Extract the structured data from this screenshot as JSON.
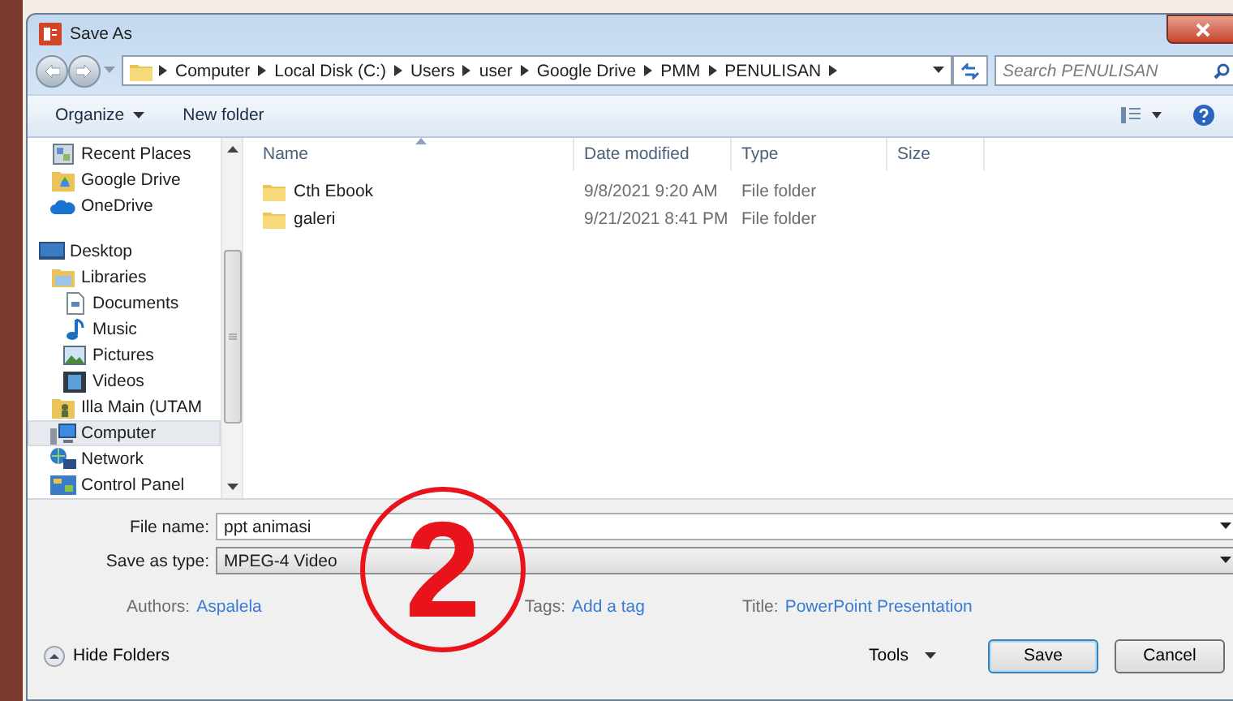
{
  "window": {
    "title": "Save As"
  },
  "address": {
    "crumbs": [
      "Computer",
      "Local Disk (C:)",
      "Users",
      "user",
      "Google Drive",
      "PMM",
      "PENULISAN"
    ]
  },
  "search": {
    "placeholder": "Search PENULISAN"
  },
  "toolbar": {
    "items": [
      {
        "label": "Organize",
        "menu": true
      },
      {
        "label": "New folder",
        "menu": false
      }
    ]
  },
  "nav": {
    "favorites": [
      {
        "label": "Recent Places",
        "kind": "recent",
        "selected": false
      },
      {
        "label": "Google Drive",
        "kind": "gdrive",
        "selected": false
      },
      {
        "label": "OneDrive",
        "kind": "cloud",
        "selected": false
      }
    ],
    "tree": [
      {
        "label": "Desktop",
        "kind": "desktop",
        "selected": false,
        "children": [
          {
            "label": "Libraries",
            "kind": "library",
            "selected": false,
            "children": [
              {
                "label": "Documents",
                "kind": "document",
                "selected": false
              },
              {
                "label": "Music",
                "kind": "music",
                "selected": false
              },
              {
                "label": "Pictures",
                "kind": "picture",
                "selected": false
              },
              {
                "label": "Videos",
                "kind": "video",
                "selected": false
              }
            ]
          },
          {
            "label": "Illa Main (UTAM",
            "kind": "user",
            "selected": false
          },
          {
            "label": "Computer",
            "kind": "computer",
            "selected": true
          },
          {
            "label": "Network",
            "kind": "network",
            "selected": false
          },
          {
            "label": "Control Panel",
            "kind": "panel",
            "selected": false
          }
        ]
      }
    ]
  },
  "files": {
    "columns": [
      "Name",
      "Date modified",
      "Type",
      "Size"
    ],
    "rows": [
      {
        "name": "Cth Ebook",
        "date": "9/8/2021 9:20 AM",
        "type": "File folder"
      },
      {
        "name": "galeri",
        "date": "9/21/2021 8:41 PM",
        "type": "File folder"
      }
    ]
  },
  "form": {
    "file_name_label": "File name:",
    "file_name": "ppt animasi",
    "type_label": "Save as type:",
    "type_value": "MPEG-4 Video",
    "meta": [
      {
        "label": "Authors:",
        "value": "Aspalela"
      },
      {
        "label": "Tags:",
        "value": "Add a tag"
      },
      {
        "label": "Title:",
        "value": "PowerPoint Presentation"
      }
    ]
  },
  "footer": {
    "hide_folders": "Hide Folders",
    "tools": "Tools",
    "buttons": [
      {
        "label": "Save",
        "default": true
      },
      {
        "label": "Cancel",
        "default": false
      }
    ]
  },
  "annotation": {
    "text": "2"
  }
}
